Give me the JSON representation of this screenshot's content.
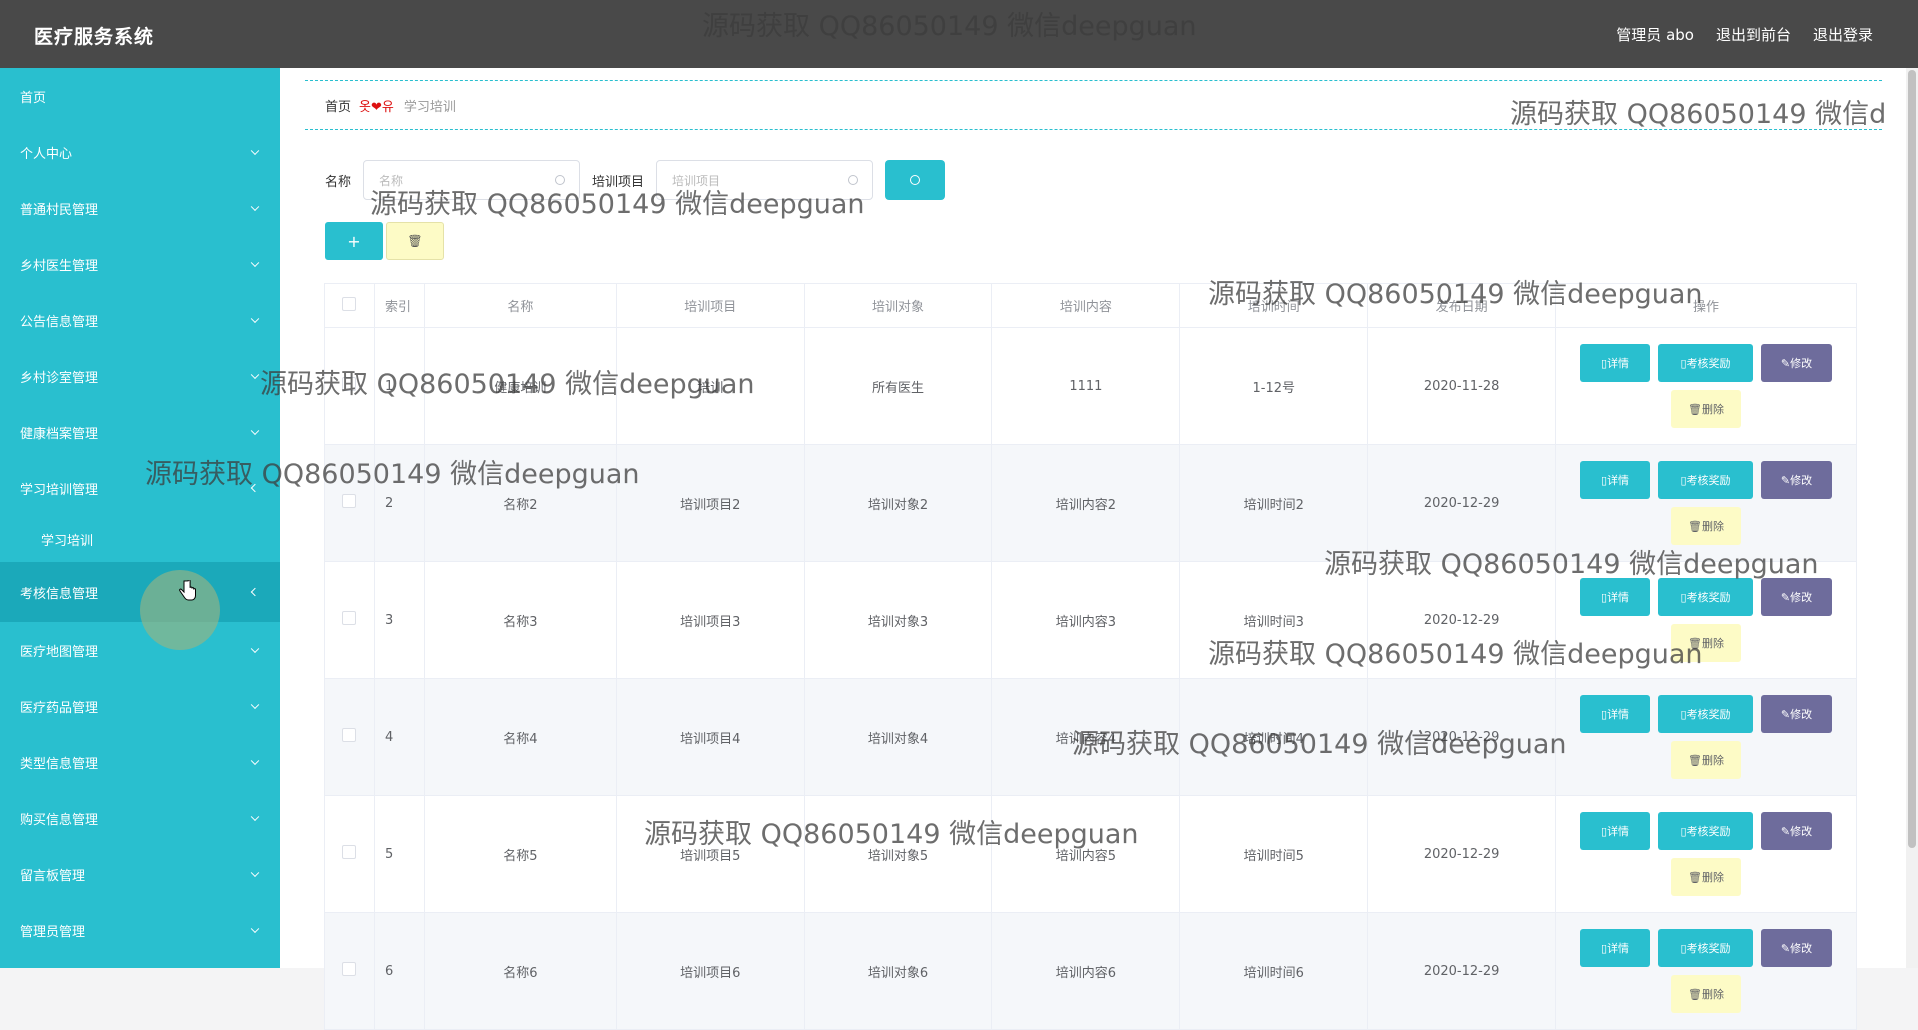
{
  "header": {
    "brand": "医疗服务系统",
    "user_label": "管理员 abo",
    "to_front": "退出到前台",
    "logout": "退出登录"
  },
  "sidebar": {
    "items": [
      {
        "label": "首页"
      },
      {
        "label": "个人中心"
      },
      {
        "label": "普通村民管理"
      },
      {
        "label": "乡村医生管理"
      },
      {
        "label": "公告信息管理"
      },
      {
        "label": "乡村诊室管理"
      },
      {
        "label": "健康档案管理"
      },
      {
        "label": "学习培训管理"
      },
      {
        "label": "学习培训"
      },
      {
        "label": "考核信息管理"
      },
      {
        "label": "医疗地图管理"
      },
      {
        "label": "医疗药品管理"
      },
      {
        "label": "类型信息管理"
      },
      {
        "label": "购买信息管理"
      },
      {
        "label": "留言板管理"
      },
      {
        "label": "管理员管理"
      }
    ]
  },
  "breadcrumb": {
    "home": "首页",
    "separator": "옷❤유",
    "current": "学习培训"
  },
  "search": {
    "name_label": "名称",
    "name_placeholder": "名称",
    "project_label": "培训项目",
    "project_placeholder": "培训项目"
  },
  "table": {
    "headers": [
      "索引",
      "名称",
      "培训项目",
      "培训对象",
      "培训内容",
      "培训时间",
      "发布日期",
      "操作"
    ],
    "rows": [
      [
        "1",
        "健康培训",
        "培训",
        "所有医生",
        "1111",
        "1-12号",
        "2020-11-28"
      ],
      [
        "2",
        "名称2",
        "培训项目2",
        "培训对象2",
        "培训内容2",
        "培训时间2",
        "2020-12-29"
      ],
      [
        "3",
        "名称3",
        "培训项目3",
        "培训对象3",
        "培训内容3",
        "培训时间3",
        "2020-12-29"
      ],
      [
        "4",
        "名称4",
        "培训项目4",
        "培训对象4",
        "培训内容4",
        "培训时间4",
        "2020-12-29"
      ],
      [
        "5",
        "名称5",
        "培训项目5",
        "培训对象5",
        "培训内容5",
        "培训时间5",
        "2020-12-29"
      ],
      [
        "6",
        "名称6",
        "培训项目6",
        "培训对象6",
        "培训内容6",
        "培训时间6",
        "2020-12-29"
      ]
    ],
    "op_labels": {
      "detail": "详情",
      "reward": "考核奖励",
      "edit": "修改",
      "delete": "删除"
    }
  },
  "watermark": "源码获取 QQ86050149 微信deepguan",
  "watermark_clipped": "源码获取 QQ86050149 微信d"
}
